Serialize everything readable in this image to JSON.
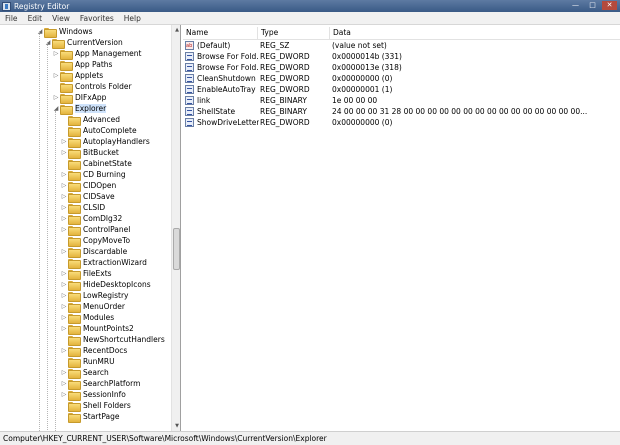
{
  "window": {
    "title": "Registry Editor",
    "icon": "registry-icon",
    "buttons": [
      "—",
      "□",
      "✕"
    ]
  },
  "menu": [
    "File",
    "Edit",
    "View",
    "Favorites",
    "Help"
  ],
  "tree": [
    {
      "label": "Windows",
      "expanded": true
    },
    {
      "label": "CurrentVersion",
      "expanded": true
    },
    {
      "label": "App Management",
      "expanded": false
    },
    {
      "label": "App Paths",
      "expanded": null
    },
    {
      "label": "Applets",
      "expanded": false
    },
    {
      "label": "Controls Folder",
      "expanded": null
    },
    {
      "label": "DIFxApp",
      "expanded": false
    },
    {
      "label": "Explorer",
      "expanded": true,
      "selected": true
    },
    {
      "label": "Advanced",
      "expanded": null
    },
    {
      "label": "AutoComplete",
      "expanded": null
    },
    {
      "label": "AutoplayHandlers",
      "expanded": false
    },
    {
      "label": "BitBucket",
      "expanded": false
    },
    {
      "label": "CabinetState",
      "expanded": null
    },
    {
      "label": "CD Burning",
      "expanded": false
    },
    {
      "label": "CIDOpen",
      "expanded": false
    },
    {
      "label": "CIDSave",
      "expanded": false
    },
    {
      "label": "CLSID",
      "expanded": false
    },
    {
      "label": "ComDlg32",
      "expanded": false
    },
    {
      "label": "ControlPanel",
      "expanded": false
    },
    {
      "label": "CopyMoveTo",
      "expanded": null
    },
    {
      "label": "Discardable",
      "expanded": false
    },
    {
      "label": "ExtractionWizard",
      "expanded": null
    },
    {
      "label": "FileExts",
      "expanded": false
    },
    {
      "label": "HideDesktopIcons",
      "expanded": false
    },
    {
      "label": "LowRegistry",
      "expanded": false
    },
    {
      "label": "MenuOrder",
      "expanded": false
    },
    {
      "label": "Modules",
      "expanded": false
    },
    {
      "label": "MountPoints2",
      "expanded": false
    },
    {
      "label": "NewShortcutHandlers",
      "expanded": null
    },
    {
      "label": "RecentDocs",
      "expanded": false
    },
    {
      "label": "RunMRU",
      "expanded": null
    },
    {
      "label": "Search",
      "expanded": false
    },
    {
      "label": "SearchPlatform",
      "expanded": false
    },
    {
      "label": "SessionInfo",
      "expanded": false
    },
    {
      "label": "Shell Folders",
      "expanded": null
    },
    {
      "label": "StartPage",
      "expanded": null
    }
  ],
  "list": {
    "columns": [
      "Name",
      "Type",
      "Data"
    ],
    "rows": [
      {
        "name": "(Default)",
        "type": "REG_SZ",
        "data": "(value not set)",
        "icon": "string-value-icon"
      },
      {
        "name": "Browse For Fold...",
        "type": "REG_DWORD",
        "data": "0x0000014b (331)",
        "icon": "binary-value-icon"
      },
      {
        "name": "Browse For Fold...",
        "type": "REG_DWORD",
        "data": "0x0000013e (318)",
        "icon": "binary-value-icon"
      },
      {
        "name": "CleanShutdown",
        "type": "REG_DWORD",
        "data": "0x00000000 (0)",
        "icon": "binary-value-icon"
      },
      {
        "name": "EnableAutoTray",
        "type": "REG_DWORD",
        "data": "0x00000001 (1)",
        "icon": "binary-value-icon"
      },
      {
        "name": "link",
        "type": "REG_BINARY",
        "data": "1e 00 00 00",
        "icon": "binary-value-icon"
      },
      {
        "name": "ShellState",
        "type": "REG_BINARY",
        "data": "24 00 00 00 31 28 00 00 00 00 00 00 00 00 00 00 00 00 00 00 00...",
        "icon": "binary-value-icon"
      },
      {
        "name": "ShowDriveLetter...",
        "type": "REG_DWORD",
        "data": "0x00000000 (0)",
        "icon": "binary-value-icon"
      }
    ]
  },
  "statusbar": {
    "path": "Computer\\HKEY_CURRENT_USER\\Software\\Microsoft\\Windows\\CurrentVersion\\Explorer"
  }
}
